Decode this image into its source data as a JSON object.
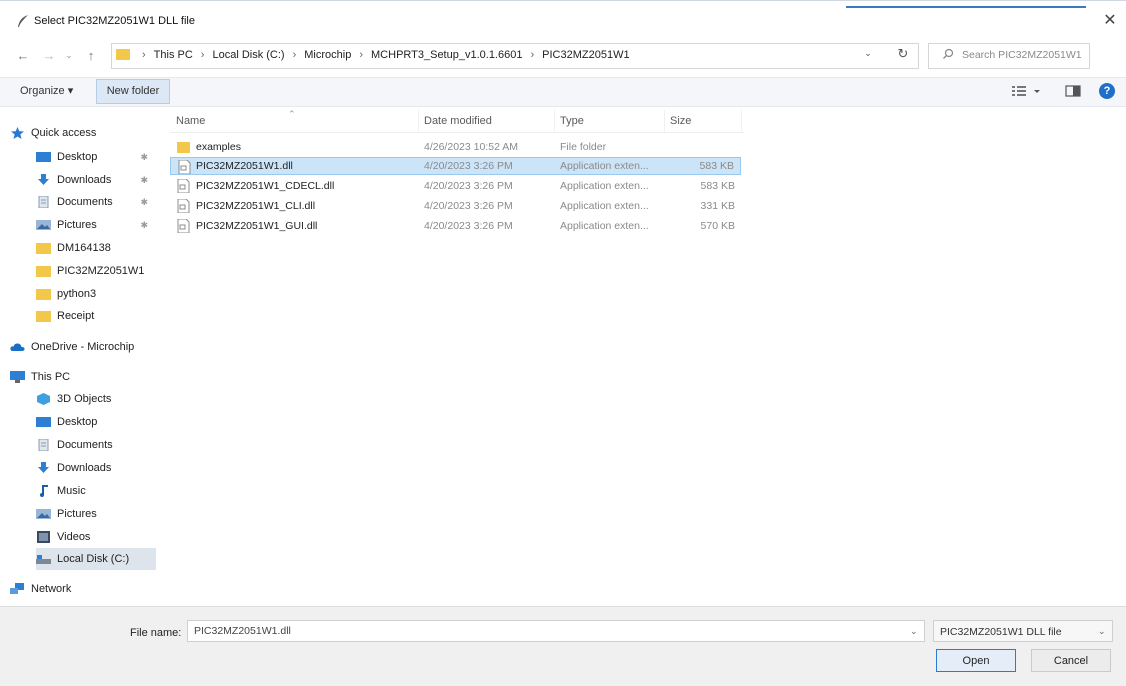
{
  "window": {
    "title": "Select PIC32MZ2051W1 DLL file",
    "close_glyph": "✕",
    "accent_color": "#3c78c8"
  },
  "address_bar": {
    "back_glyph": "←",
    "forward_glyph": "→",
    "recent_glyph": "⌄",
    "up_glyph": "↑",
    "crumbs": [
      "This PC",
      "Local Disk (C:)",
      "Microchip",
      "MCHPRT3_Setup_v1.0.1.6601",
      "PIC32MZ2051W1"
    ],
    "separator": "›",
    "search_placeholder": "Search PIC32MZ2051W1"
  },
  "toolbar": {
    "organize_label": "Organize ▾",
    "new_folder_label": "New folder",
    "help_label": "?"
  },
  "nav": {
    "items": [
      {
        "label": "Quick access",
        "icon": "star-icon"
      },
      {
        "label": "Desktop",
        "icon": "desktop-icon",
        "pinned": true
      },
      {
        "label": "Downloads",
        "icon": "download-icon",
        "pinned": true
      },
      {
        "label": "Documents",
        "icon": "documents-icon",
        "pinned": true
      },
      {
        "label": "Pictures",
        "icon": "pictures-icon",
        "pinned": true
      },
      {
        "label": "DM164138",
        "icon": "folder-icon"
      },
      {
        "label": "PIC32MZ2051W1",
        "icon": "folder-icon"
      },
      {
        "label": "python3",
        "icon": "folder-icon"
      },
      {
        "label": "Receipt",
        "icon": "folder-icon"
      },
      {
        "label": "OneDrive - Microchip",
        "icon": "cloud-icon"
      },
      {
        "label": "This PC",
        "icon": "computer-icon"
      },
      {
        "label": "3D Objects",
        "icon": "cube-icon"
      },
      {
        "label": "Desktop",
        "icon": "desktop-icon"
      },
      {
        "label": "Documents",
        "icon": "documents-icon"
      },
      {
        "label": "Downloads",
        "icon": "download-icon"
      },
      {
        "label": "Music",
        "icon": "music-icon"
      },
      {
        "label": "Pictures",
        "icon": "pictures-icon"
      },
      {
        "label": "Videos",
        "icon": "video-icon"
      },
      {
        "label": "Local Disk (C:)",
        "icon": "drive-icon"
      },
      {
        "label": "Network",
        "icon": "network-icon"
      }
    ],
    "pin_glyph": "✱"
  },
  "files": {
    "columns": [
      "Name",
      "Date modified",
      "Type",
      "Size"
    ],
    "rows": [
      {
        "name": "examples",
        "date": "4/26/2023 10:52 AM",
        "type": "File folder",
        "size": "",
        "icon": "folder-icon"
      },
      {
        "name": "PIC32MZ2051W1.dll",
        "date": "4/20/2023 3:26 PM",
        "type": "Application exten...",
        "size": "583 KB",
        "icon": "dll-file-icon",
        "selected": true
      },
      {
        "name": "PIC32MZ2051W1_CDECL.dll",
        "date": "4/20/2023 3:26 PM",
        "type": "Application exten...",
        "size": "583 KB",
        "icon": "dll-file-icon"
      },
      {
        "name": "PIC32MZ2051W1_CLI.dll",
        "date": "4/20/2023 3:26 PM",
        "type": "Application exten...",
        "size": "331 KB",
        "icon": "dll-file-icon"
      },
      {
        "name": "PIC32MZ2051W1_GUI.dll",
        "date": "4/20/2023 3:26 PM",
        "type": "Application exten...",
        "size": "570 KB",
        "icon": "dll-file-icon"
      }
    ]
  },
  "footer": {
    "file_name_label": "File name:",
    "file_name_value": "PIC32MZ2051W1.dll",
    "filter_value": "PIC32MZ2051W1 DLL file",
    "open_label": "Open",
    "cancel_label": "Cancel",
    "dropdown_glyph": "⌄"
  }
}
